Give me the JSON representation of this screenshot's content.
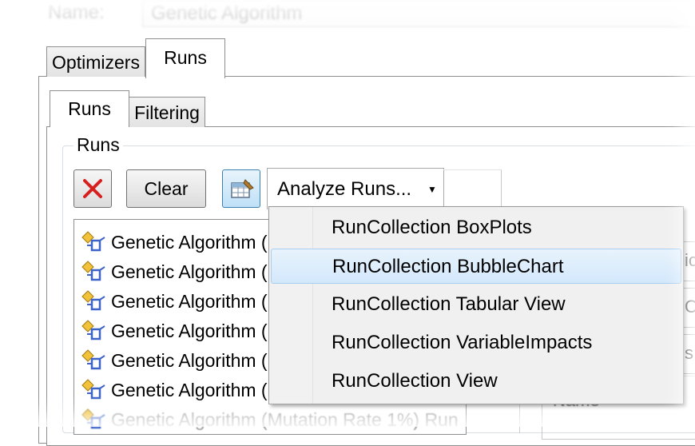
{
  "top": {
    "name_label": "Name:",
    "name_value": "Genetic Algorithm"
  },
  "outer_tabs": [
    {
      "label": "Optimizers",
      "active": false
    },
    {
      "label": "Runs",
      "active": true
    }
  ],
  "inner_tabs": [
    {
      "label": "Runs",
      "active": true
    },
    {
      "label": "Filtering",
      "active": false
    }
  ],
  "runs_group": {
    "title": "Runs",
    "toolbar": {
      "clear_label": "Clear",
      "analyze_label": "Analyze Runs..."
    },
    "items": [
      {
        "label": "Genetic Algorithm ("
      },
      {
        "label": "Genetic Algorithm ("
      },
      {
        "label": "Genetic Algorithm ("
      },
      {
        "label": "Genetic Algorithm ("
      },
      {
        "label": "Genetic Algorithm ("
      },
      {
        "label": "Genetic Algorithm ("
      },
      {
        "label": "Genetic Algorithm (Mutation Rate 1%) Run"
      }
    ]
  },
  "analyze_menu": {
    "items": [
      {
        "label": "RunCollection BoxPlots",
        "highlighted": false
      },
      {
        "label": "RunCollection BubbleChart",
        "highlighted": true
      },
      {
        "label": "RunCollection Tabular View",
        "highlighted": false
      },
      {
        "label": "RunCollection VariableImpacts",
        "highlighted": false
      },
      {
        "label": "RunCollection View",
        "highlighted": false
      }
    ]
  },
  "right_side": {
    "box1": "ic",
    "box2": "C",
    "box3": "s",
    "name_label": "Name"
  },
  "colors": {
    "highlight_bg": "#d3e8fb",
    "highlight_border": "#a7cdf0",
    "delete_red": "#d6201e",
    "icon_yellow": "#f2c23a",
    "icon_blue": "#3d63c9"
  }
}
